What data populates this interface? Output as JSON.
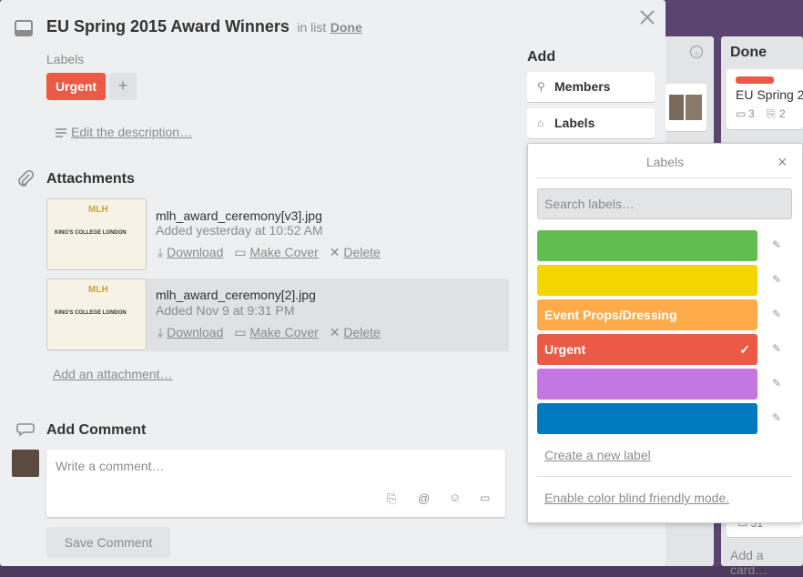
{
  "card": {
    "title": "EU Spring 2015 Award Winners",
    "in_list_prefix": "in list",
    "list_name": "Done",
    "labels_heading": "Labels",
    "urgent_label": "Urgent",
    "plus": "+",
    "edit_description": "Edit the description…"
  },
  "attachments": {
    "heading": "Attachments",
    "items": [
      {
        "name": "mlh_award_ceremony[v3].jpg",
        "meta": "Added yesterday at 10:52 AM",
        "download": "Download",
        "make_cover": "Make Cover",
        "delete": "Delete",
        "thumb_logo": "MLH",
        "thumb_text": "KING'S COLLEGE LONDON"
      },
      {
        "name": "mlh_award_ceremony[2].jpg",
        "meta": "Added Nov 9 at 9:31 PM",
        "download": "Download",
        "make_cover": "Make Cover",
        "delete": "Delete",
        "thumb_logo": "MLH",
        "thumb_text": "KING'S COLLEGE LONDON"
      }
    ],
    "add_attachment": "Add an attachment…"
  },
  "comment": {
    "heading": "Add Comment",
    "placeholder": "Write a comment…",
    "save": "Save Comment"
  },
  "sidebar": {
    "heading": "Add",
    "members": "Members",
    "labels": "Labels"
  },
  "labels_popover": {
    "title": "Labels",
    "close": "×",
    "search_placeholder": "Search labels…",
    "labels": [
      {
        "name": "",
        "color": "#61bd4f",
        "selected": false
      },
      {
        "name": "",
        "color": "#f2d600",
        "selected": false
      },
      {
        "name": "Event Props/Dressing",
        "color": "#ffab4a",
        "selected": false
      },
      {
        "name": "Urgent",
        "color": "#eb5a46",
        "selected": true
      },
      {
        "name": "",
        "color": "#c377e0",
        "selected": false
      },
      {
        "name": "",
        "color": "#0079bf",
        "selected": false
      }
    ],
    "create_label": "Create a new label",
    "color_blind": "Enable color blind friendly mode."
  },
  "board": {
    "done_list_title": "Done",
    "done_card_title": "EU Spring 2",
    "done_card_comments": "3",
    "done_card_attachments": "2",
    "bottom_card_meta": "31",
    "add_card": "Add a card…"
  }
}
